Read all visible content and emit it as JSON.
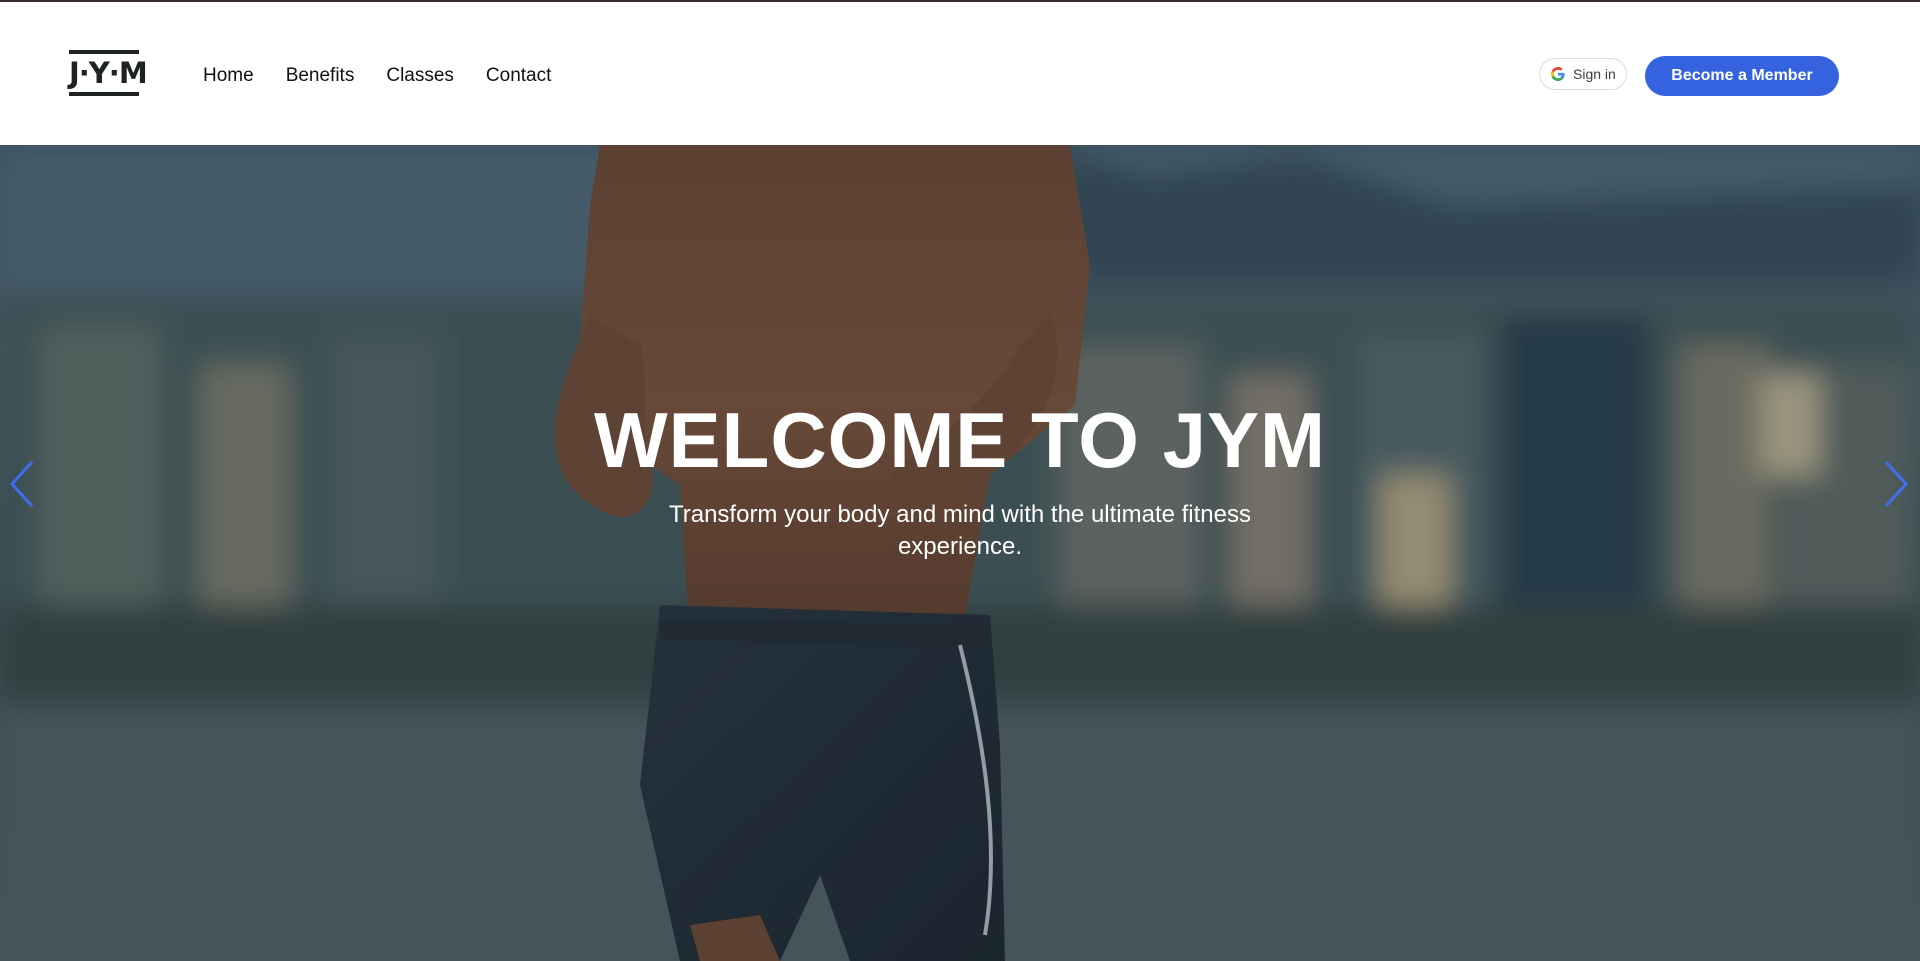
{
  "brand": {
    "logo_text": "J·Y·M",
    "dark_color": "#1d2222"
  },
  "nav": {
    "items": [
      {
        "label": "Home"
      },
      {
        "label": "Benefits"
      },
      {
        "label": "Classes"
      },
      {
        "label": "Contact"
      }
    ]
  },
  "auth": {
    "signin_label": "Sign in",
    "icon": "google-icon"
  },
  "cta": {
    "label": "Become a Member",
    "color": "#3563e0"
  },
  "hero": {
    "title": "WELCOME TO JYM",
    "subtitle": "Transform your body and mind with the ultimate fitness experience.",
    "image": "runner-on-waterfront-photo",
    "prev_icon": "chevron-left-icon",
    "next_icon": "chevron-right-icon",
    "arrow_color": "#3d6ff0"
  }
}
